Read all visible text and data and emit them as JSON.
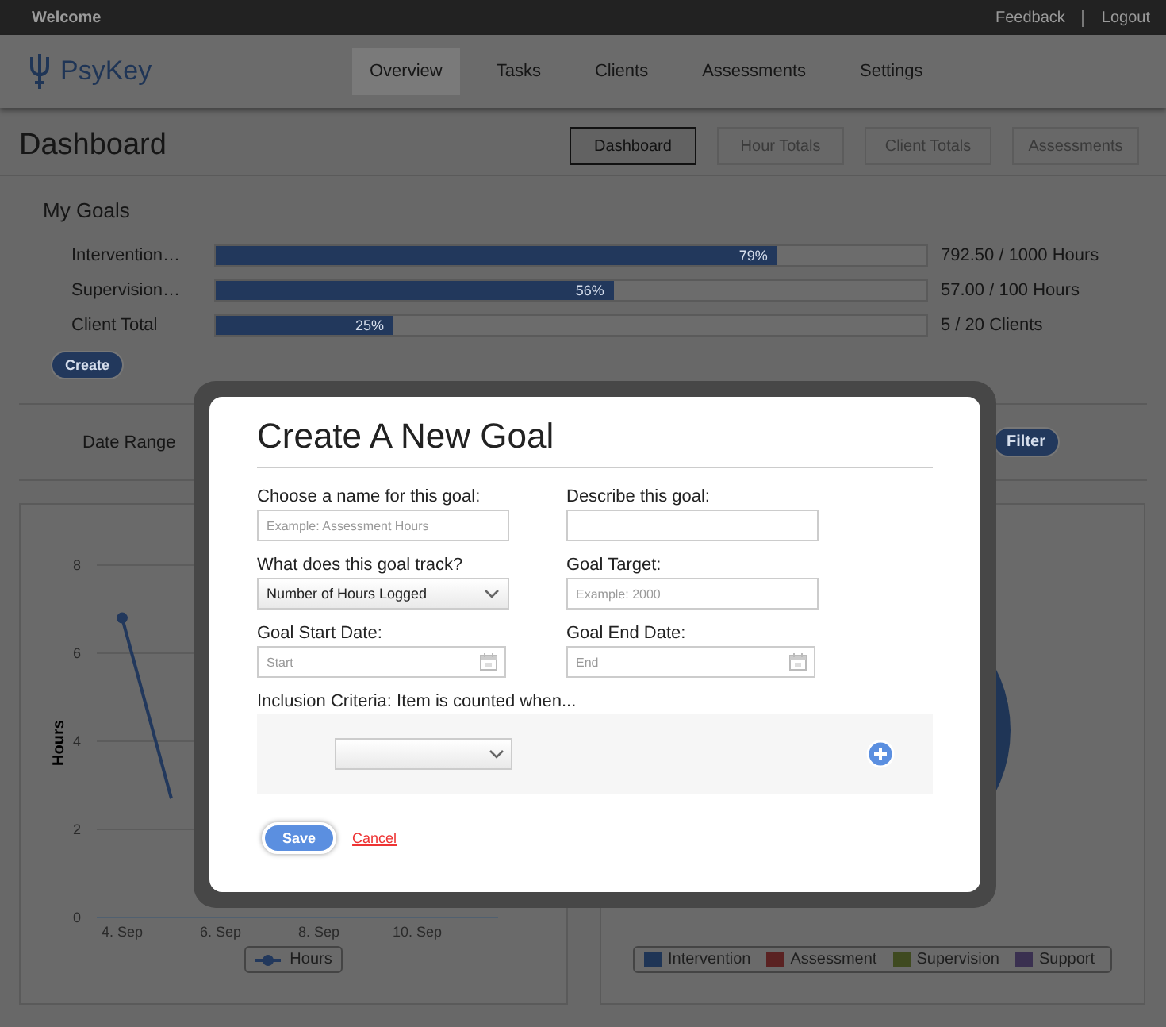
{
  "topbar": {
    "title": "Welcome",
    "links": [
      "Feedback",
      "Logout"
    ]
  },
  "brand": "PsyKey",
  "nav": [
    {
      "label": "Overview",
      "selected": true
    },
    {
      "label": "Tasks",
      "selected": false
    },
    {
      "label": "Clients",
      "selected": false
    },
    {
      "label": "Assessments",
      "selected": false
    },
    {
      "label": "Settings",
      "selected": false
    }
  ],
  "page_title": "Dashboard",
  "views": [
    {
      "label": "Dashboard",
      "selected": true
    },
    {
      "label": "Hour Totals",
      "selected": false
    },
    {
      "label": "Client Totals",
      "selected": false
    },
    {
      "label": "Assessments",
      "selected": false
    }
  ],
  "goals": {
    "title": "My Goals",
    "create": "Create",
    "items": [
      {
        "name": "Intervention…",
        "level": 0.79,
        "percent": "79%",
        "reading": "792.50 / 1000 Hours"
      },
      {
        "name": "Supervision…",
        "level": 0.56,
        "percent": "56%",
        "reading": "57.00 / 100 Hours"
      },
      {
        "name": "Client Total",
        "level": 0.25,
        "percent": "25%",
        "reading": "5 / 20 Clients"
      }
    ]
  },
  "filter": {
    "label": "Date Range",
    "button": "Filter"
  },
  "line_chart": {
    "chart_data": {
      "type": "line",
      "ylabel": "Hours",
      "yticks": [
        0,
        2,
        4,
        6,
        8
      ],
      "ylim": [
        0,
        8
      ],
      "grid": true,
      "categories": [
        "4. Sep",
        null,
        "6. Sep",
        null,
        "8. Sep",
        null,
        "10. Sep",
        null
      ],
      "series": [
        {
          "name": "Hours",
          "color": "#22385c",
          "values": [
            6.8,
            2.7,
            null,
            null,
            null,
            null,
            null,
            null
          ]
        }
      ]
    }
  },
  "pie_chart": {
    "legend": [
      {
        "label": "Intervention",
        "color": "#1f3556"
      },
      {
        "label": "Assessment",
        "color": "#5a2222"
      },
      {
        "label": "Supervision",
        "color": "#3f4a20"
      },
      {
        "label": "Support",
        "color": "#3a3050"
      }
    ]
  },
  "modal": {
    "title": "Create A New Goal",
    "fields": [
      {
        "kind": "text",
        "label": "Choose a name for this goal:",
        "placeholder": "Example: Assessment Hours"
      },
      {
        "kind": "text",
        "label": "Describe this goal:"
      },
      {
        "kind": "select",
        "label": "What does this goal track?",
        "value": "Number of Hours Logged"
      },
      {
        "kind": "text",
        "label": "Goal Target:",
        "placeholder": "Example: 2000"
      },
      {
        "kind": "date",
        "label": "Goal Start Date:",
        "placeholder": "Start"
      },
      {
        "kind": "date",
        "label": "Goal End Date:",
        "placeholder": "End"
      }
    ],
    "criteria": {
      "label": "Inclusion Criteria: Item is counted when..."
    },
    "save": "Save",
    "cancel": "Cancel"
  }
}
